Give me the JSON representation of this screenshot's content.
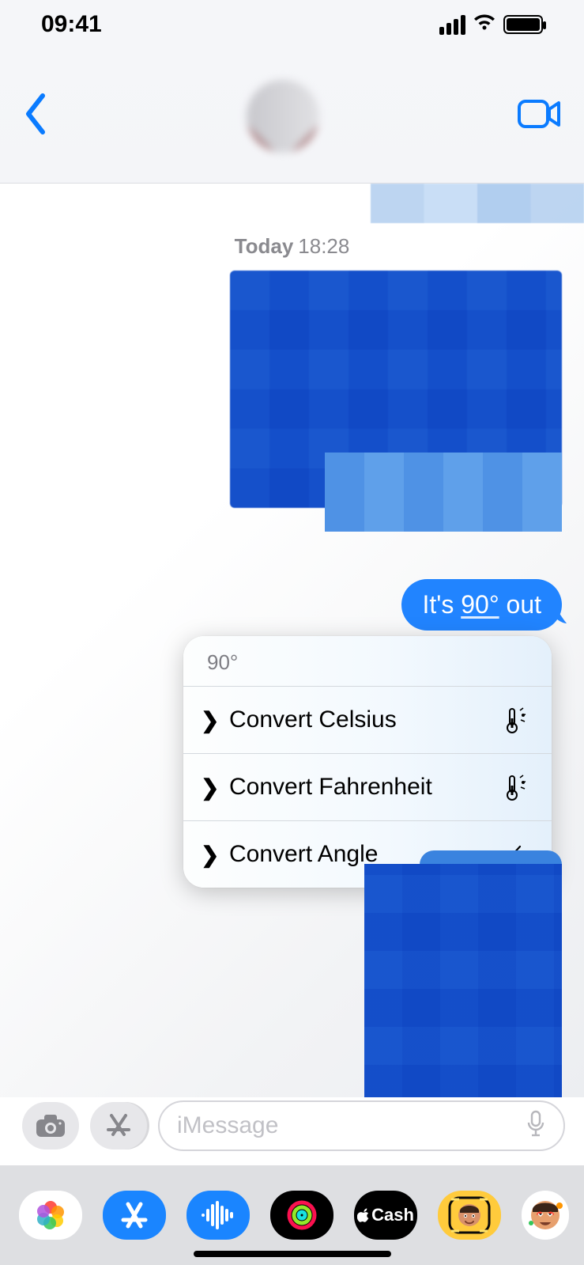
{
  "status": {
    "time": "09:41"
  },
  "timestamp": {
    "day": "Today",
    "time": "18:28"
  },
  "message": {
    "prefix": "It's ",
    "value": "90°",
    "suffix": " out"
  },
  "popup": {
    "title": "90°",
    "items": [
      {
        "label": "Convert Celsius",
        "icon": "thermometer-icon"
      },
      {
        "label": "Convert Fahrenheit",
        "icon": "thermometer-icon"
      },
      {
        "label": "Convert Angle",
        "icon": "angle-icon"
      }
    ]
  },
  "input": {
    "placeholder": "iMessage"
  },
  "appstrip": {
    "cash_label": "Cash"
  }
}
